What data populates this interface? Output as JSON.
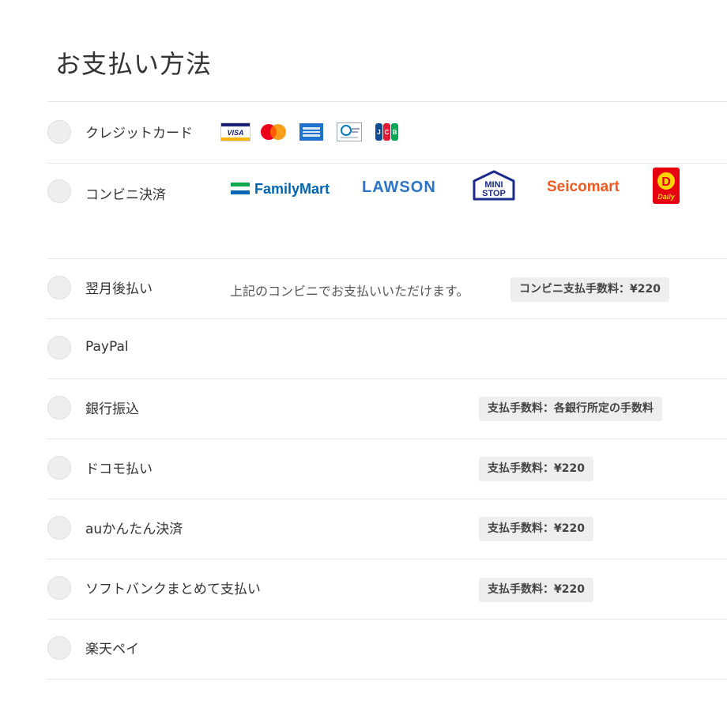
{
  "page": {
    "title": "お支払い方法"
  },
  "payment_methods": [
    {
      "label": "クレジットカード",
      "card_brands": [
        "VISA",
        "Mastercard",
        "American Express",
        "Diners Club",
        "JCB"
      ]
    },
    {
      "label": "コンビニ決済",
      "stores": [
        "FamilyMart",
        "LAWSON",
        "MINI STOP",
        "Seicomart",
        "Daily"
      ],
      "note": "上記のコンビニでお支払いいただけます。",
      "fee": "コンビニ支払手数料：¥220"
    },
    {
      "label": "翌月後払い"
    },
    {
      "label": "PayPal"
    },
    {
      "label": "銀行振込",
      "fee": "支払手数料：各銀行所定の手数料"
    },
    {
      "label": "ドコモ払い",
      "fee": "支払手数料：¥220"
    },
    {
      "label": "auかんたん決済",
      "fee": "支払手数料：¥220"
    },
    {
      "label": "ソフトバンクまとめて支払い",
      "fee": "支払手数料：¥220"
    },
    {
      "label": "楽天ペイ"
    }
  ],
  "colors": {
    "familymart_green": "#0aa64e",
    "familymart_blue": "#0066b3",
    "lawson_blue": "#2a74c9",
    "ministop_navy": "#1b2a8c",
    "seicomart_orange": "#f05a22",
    "daily_red": "#e60012",
    "daily_yellow": "#ffd400"
  }
}
